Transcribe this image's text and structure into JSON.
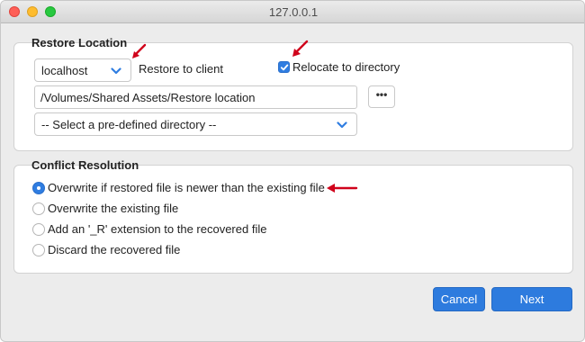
{
  "window": {
    "title": "127.0.0.1"
  },
  "restore_location": {
    "heading": "Restore Location",
    "client_select": {
      "value": "localhost",
      "icon": "chevron-down-icon"
    },
    "restore_label": "Restore to client",
    "relocate": {
      "label": "Relocate to directory",
      "checked": true
    },
    "path_field": {
      "value": "/Volumes/Shared Assets/Restore location"
    },
    "browse_button": {
      "label": "•••"
    },
    "directory_select": {
      "value": "-- Select a pre-defined directory --",
      "icon": "chevron-down-icon"
    }
  },
  "conflict_resolution": {
    "heading": "Conflict Resolution",
    "options": [
      {
        "label": "Overwrite if restored file is newer than the existing file",
        "selected": true
      },
      {
        "label": "Overwrite the existing file",
        "selected": false
      },
      {
        "label": "Add an '_R' extension to the recovered file",
        "selected": false
      },
      {
        "label": "Discard the recovered file",
        "selected": false
      }
    ]
  },
  "footer": {
    "cancel_label": "Cancel",
    "next_label": "Next"
  },
  "colors": {
    "accent": "#2d7bde",
    "annotation_arrow": "#d0021b"
  }
}
